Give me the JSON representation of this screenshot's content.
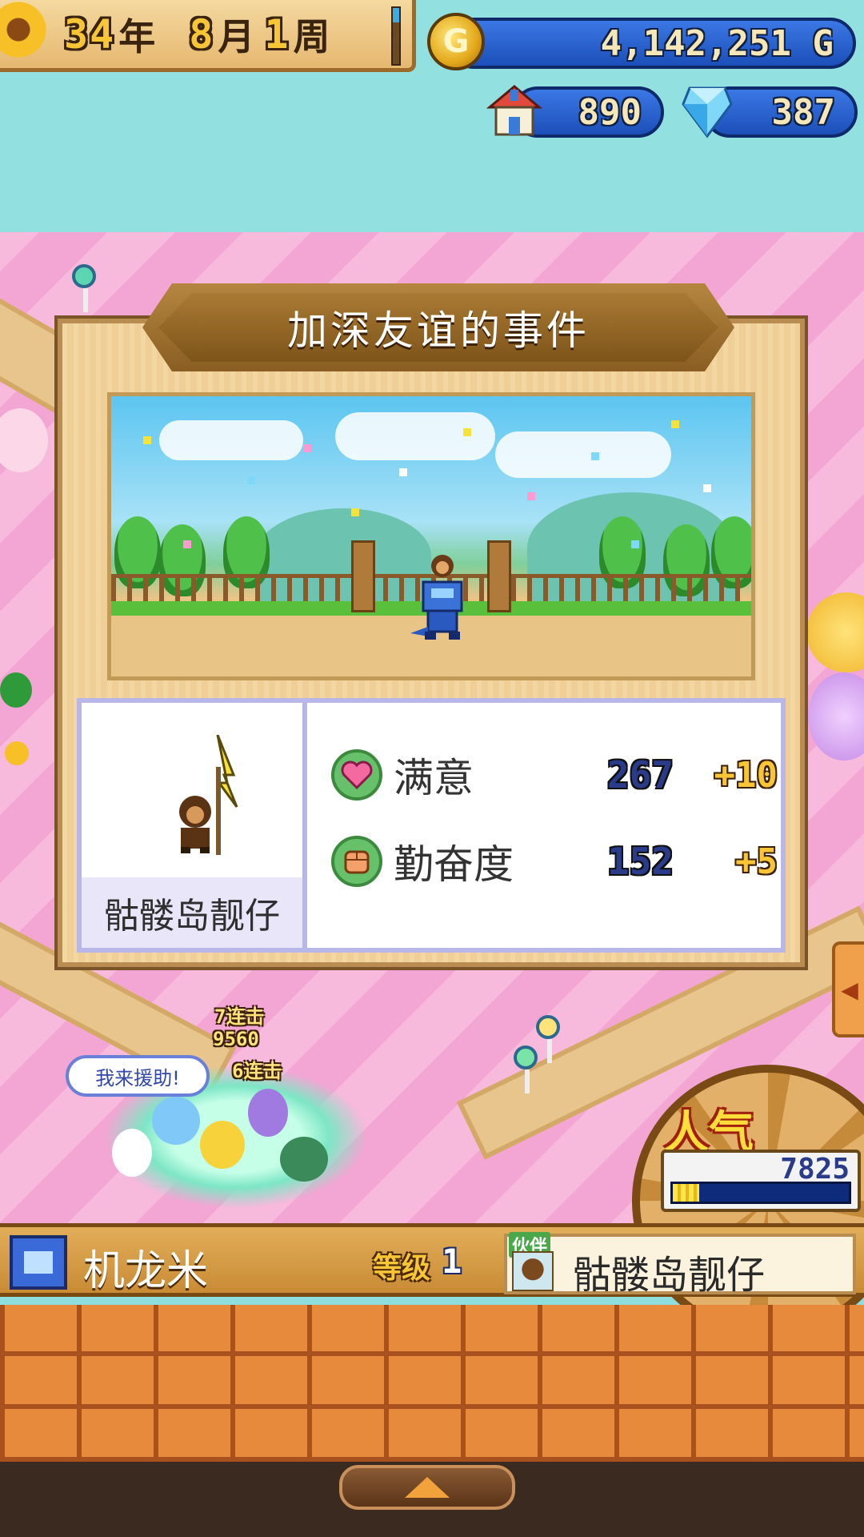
{
  "hud": {
    "year": "34",
    "year_unit": "年",
    "month": "8",
    "month_unit": "月",
    "week": "1",
    "week_unit": "周",
    "gold": "4,142,251 G",
    "buildings": "890",
    "crystals": "387"
  },
  "dialog": {
    "title": "加深友谊的事件",
    "character_name": "骷髅岛靓仔",
    "stats": [
      {
        "label": "满意",
        "value": "267",
        "delta": "+10",
        "icon": "heart-icon"
      },
      {
        "label": "勤奋度",
        "value": "152",
        "delta": "+5",
        "icon": "fist-icon"
      }
    ]
  },
  "world": {
    "speech_bubble": "我来援助!",
    "combos": [
      {
        "label": "7连击"
      },
      {
        "label": "9560"
      },
      {
        "label": "6连击"
      }
    ],
    "popularity_label": "人气",
    "popularity_value": "7825",
    "popularity_fill": 0.15
  },
  "status_bar": {
    "name": "机龙米",
    "level_label": "等级",
    "level_value": "1",
    "partner_tag": "伙伴",
    "partner_name": "骷髅岛靓仔"
  },
  "colors": {
    "sky": "#93e0e0",
    "hud_blue": "#1c4fb8",
    "gold": "#f7c536",
    "panel_border": "#b9b6ea"
  }
}
